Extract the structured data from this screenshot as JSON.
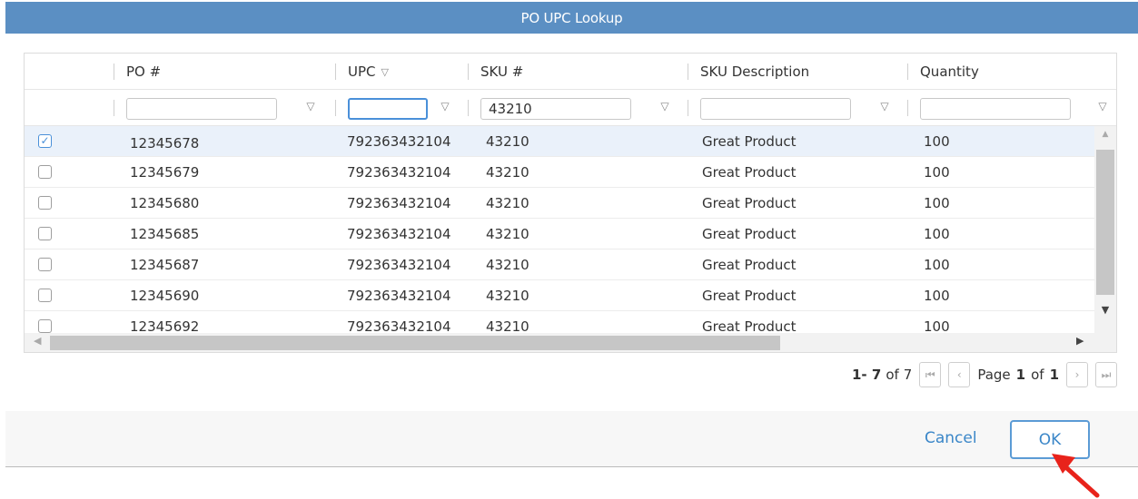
{
  "dialog": {
    "title": "PO UPC Lookup"
  },
  "colors": {
    "accent": "#5b8fc3",
    "annotation": "#e8231b"
  },
  "columns": [
    {
      "label": "PO #",
      "sortable": false
    },
    {
      "label": "UPC",
      "sortable": true
    },
    {
      "label": "SKU #",
      "sortable": false
    },
    {
      "label": "SKU Description",
      "sortable": false
    },
    {
      "label": "Quantity",
      "sortable": false
    }
  ],
  "filters": {
    "po": "",
    "upc": "",
    "sku": "43210",
    "description": "",
    "quantity": ""
  },
  "rows": [
    {
      "checked": true,
      "po": "12345678",
      "upc": "792363432104",
      "sku": "43210",
      "description": "Great Product",
      "quantity": "100"
    },
    {
      "checked": false,
      "po": "12345679",
      "upc": "792363432104",
      "sku": "43210",
      "description": "Great Product",
      "quantity": "100"
    },
    {
      "checked": false,
      "po": "12345680",
      "upc": "792363432104",
      "sku": "43210",
      "description": "Great Product",
      "quantity": "100"
    },
    {
      "checked": false,
      "po": "12345685",
      "upc": "792363432104",
      "sku": "43210",
      "description": "Great Product",
      "quantity": "100"
    },
    {
      "checked": false,
      "po": "12345687",
      "upc": "792363432104",
      "sku": "43210",
      "description": "Great Product",
      "quantity": "100"
    },
    {
      "checked": false,
      "po": "12345690",
      "upc": "792363432104",
      "sku": "43210",
      "description": "Great Product",
      "quantity": "100"
    },
    {
      "checked": false,
      "po": "12345692",
      "upc": "792363432104",
      "sku": "43210",
      "description": "Great Product",
      "quantity": "100"
    }
  ],
  "pager": {
    "range": "1- 7",
    "of_label": "of",
    "total": "7",
    "page_label": "Page",
    "page": "1",
    "page_of_label": "of",
    "page_count": "1"
  },
  "footer": {
    "cancel_label": "Cancel",
    "ok_label": "OK"
  }
}
